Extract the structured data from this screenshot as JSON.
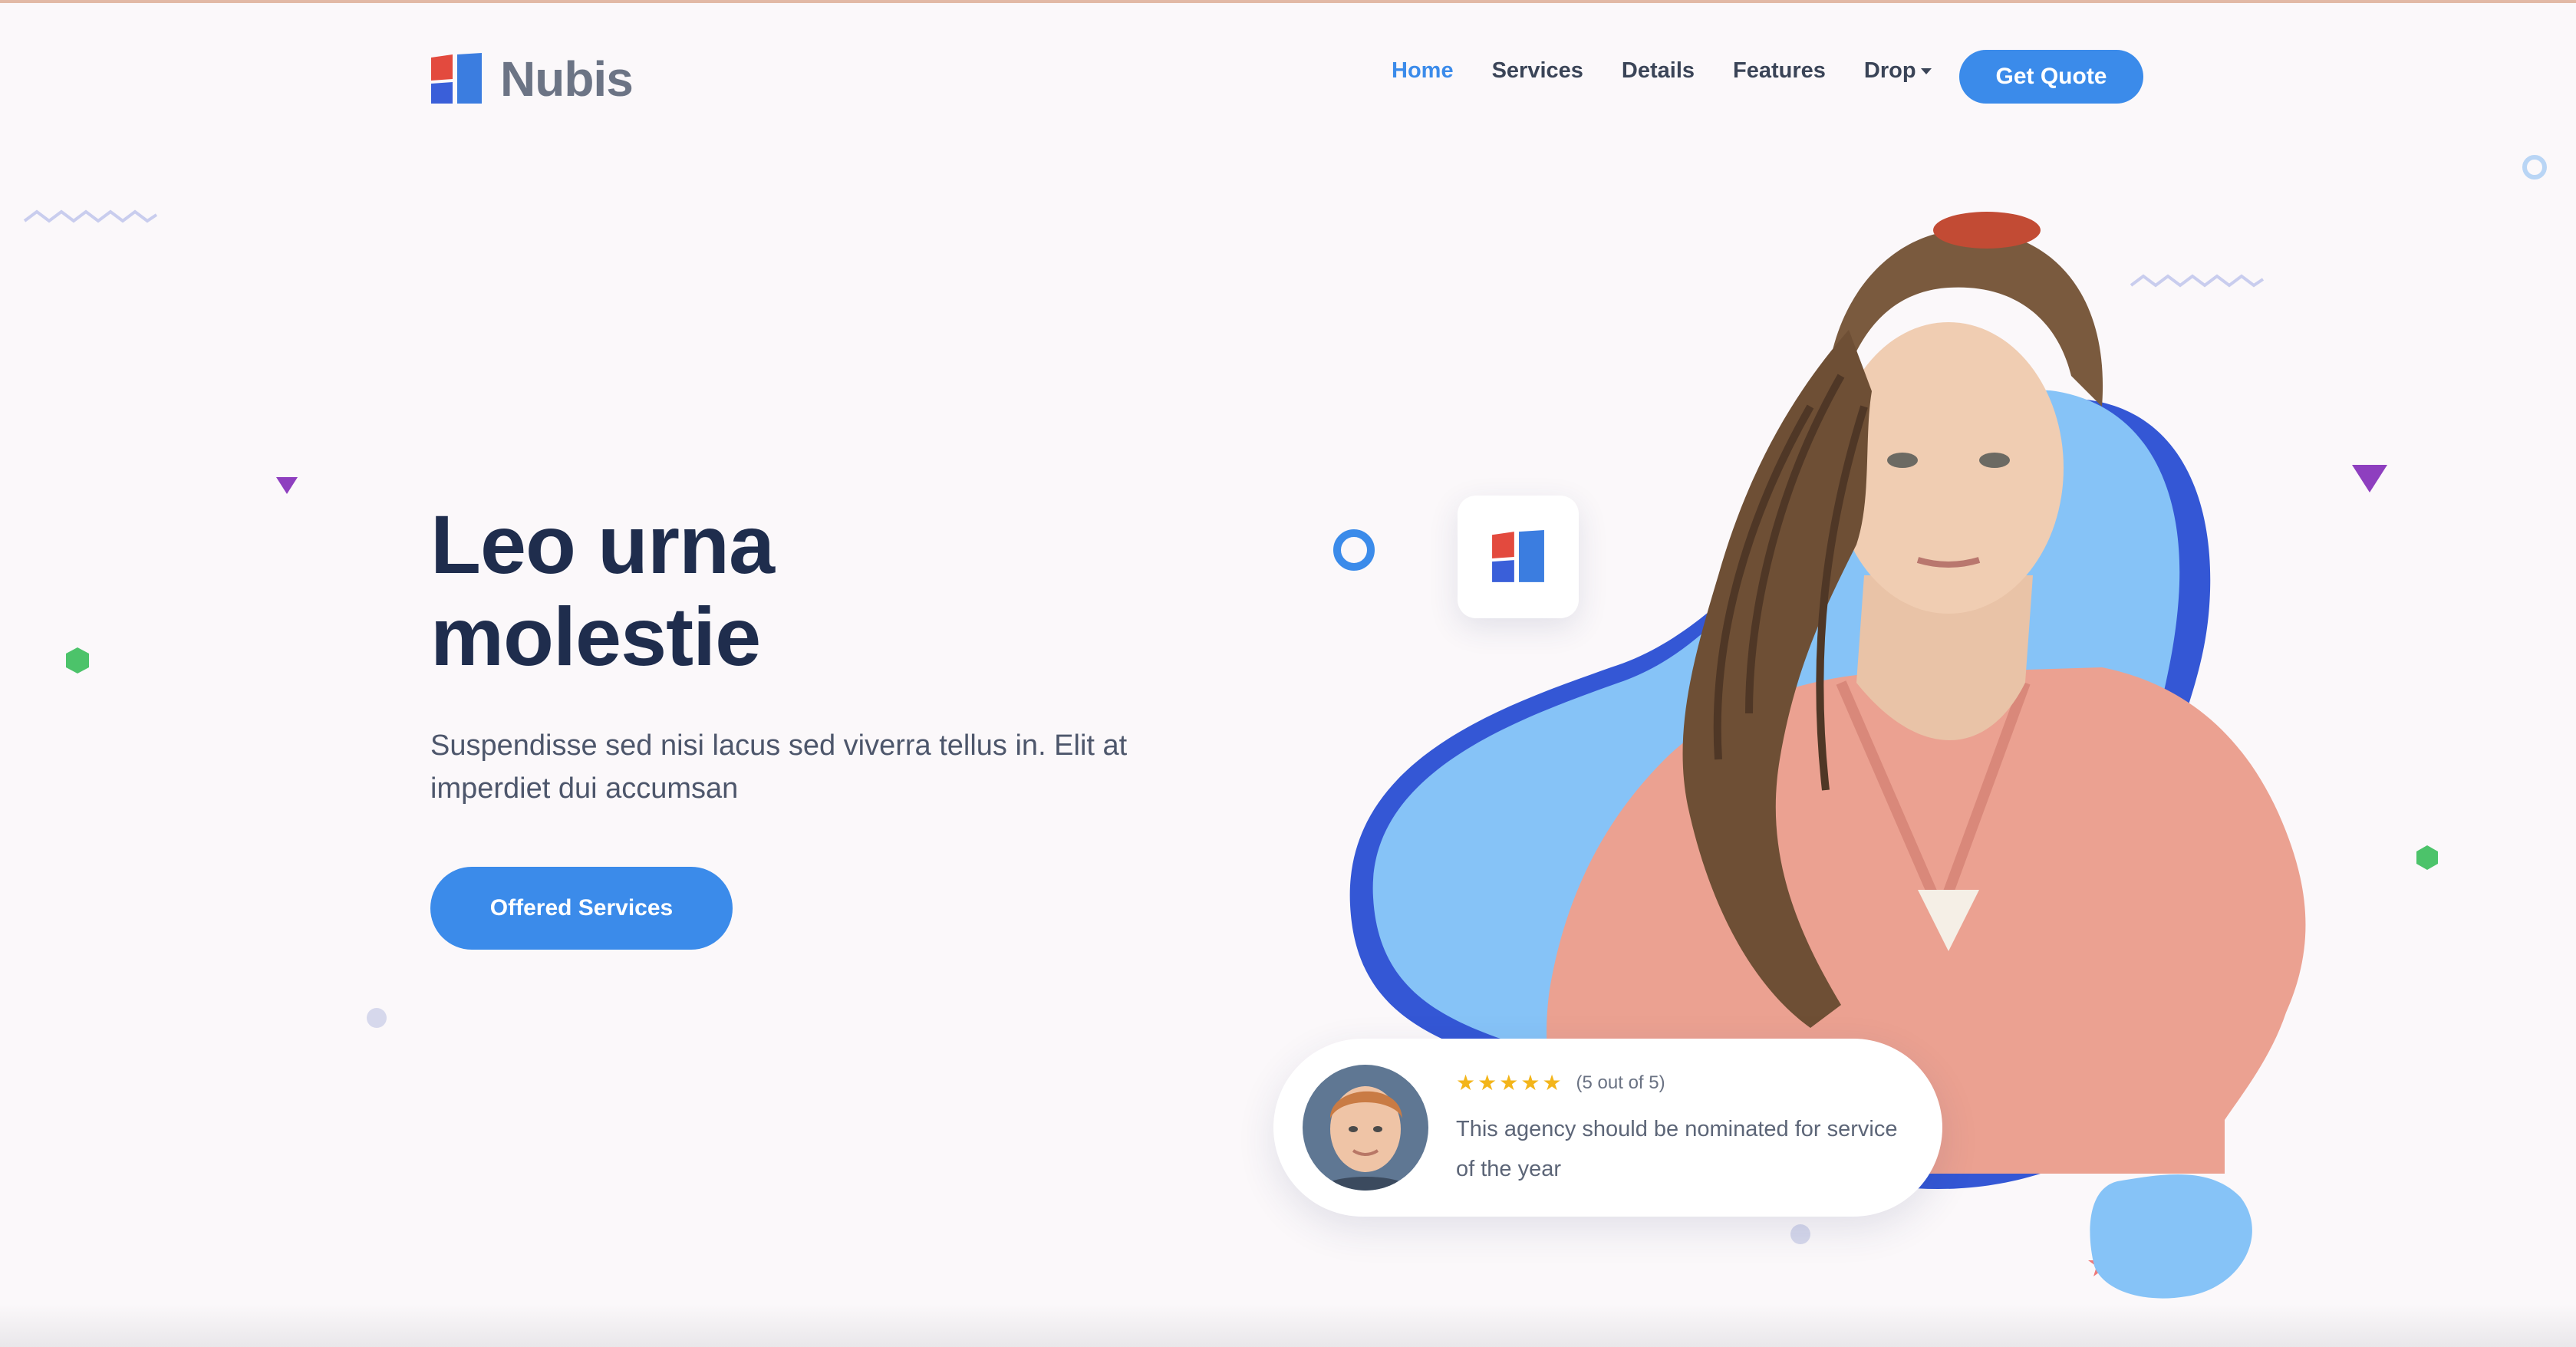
{
  "brand": {
    "name": "Nubis",
    "colors": {
      "primary": "#3b8bea",
      "dark": "#1f2d4d",
      "logo_red": "#e34a3e",
      "logo_blue": "#3a5fd9"
    }
  },
  "nav": {
    "items": [
      {
        "label": "Home",
        "active": true
      },
      {
        "label": "Services",
        "active": false
      },
      {
        "label": "Details",
        "active": false
      },
      {
        "label": "Features",
        "active": false
      },
      {
        "label": "Drop",
        "active": false,
        "dropdown": true
      }
    ],
    "cta_label": "Get Quote"
  },
  "hero": {
    "title_line1": "Leo urna",
    "title_line2": "molestie",
    "description": "Suspendisse sed nisi lacus sed viverra tellus in. Elit at imperdiet dui accumsan",
    "cta_label": "Offered Services"
  },
  "review": {
    "stars": 5,
    "rating_text": "(5 out of 5)",
    "text": "This agency should be nominated for service of the year",
    "star_icon": "star-icon"
  },
  "icons": [
    "logo-mark",
    "chevron-down-icon",
    "star-icon",
    "avatar"
  ]
}
